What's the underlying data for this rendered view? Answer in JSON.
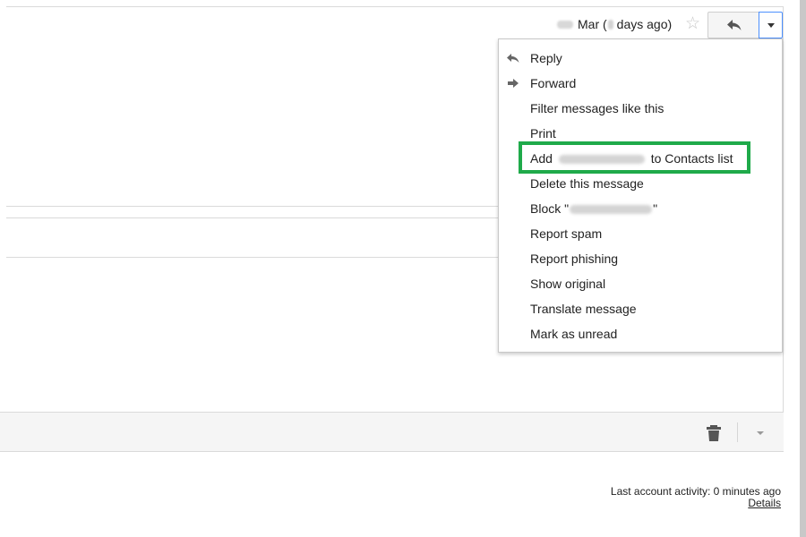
{
  "header": {
    "date_text": "Mar (",
    "days_ago_text": "days ago)",
    "star_icon": "star-outline-icon",
    "reply_icon": "reply-arrow-icon",
    "more_icon": "caret-down-icon"
  },
  "menu": {
    "items": [
      {
        "label": "Reply",
        "icon": "reply-arrow-icon"
      },
      {
        "label": "Forward",
        "icon": "forward-arrow-icon"
      },
      {
        "label": "Filter messages like this"
      },
      {
        "label": "Print"
      },
      {
        "label_prefix": "Add",
        "label_suffix": "to Contacts list"
      },
      {
        "label": "Delete this message"
      },
      {
        "label_prefix": "Block \"",
        "label_suffix": "\""
      },
      {
        "label": "Report spam"
      },
      {
        "label": "Report phishing"
      },
      {
        "label": "Show original"
      },
      {
        "label": "Translate message"
      },
      {
        "label": "Mark as unread"
      }
    ],
    "highlight_color": "#1faa4a"
  },
  "toolbar": {
    "delete_icon": "trash-icon",
    "more_icon": "caret-down-icon"
  },
  "footer": {
    "activity": "Last account activity: 0 minutes ago",
    "details": "Details"
  }
}
